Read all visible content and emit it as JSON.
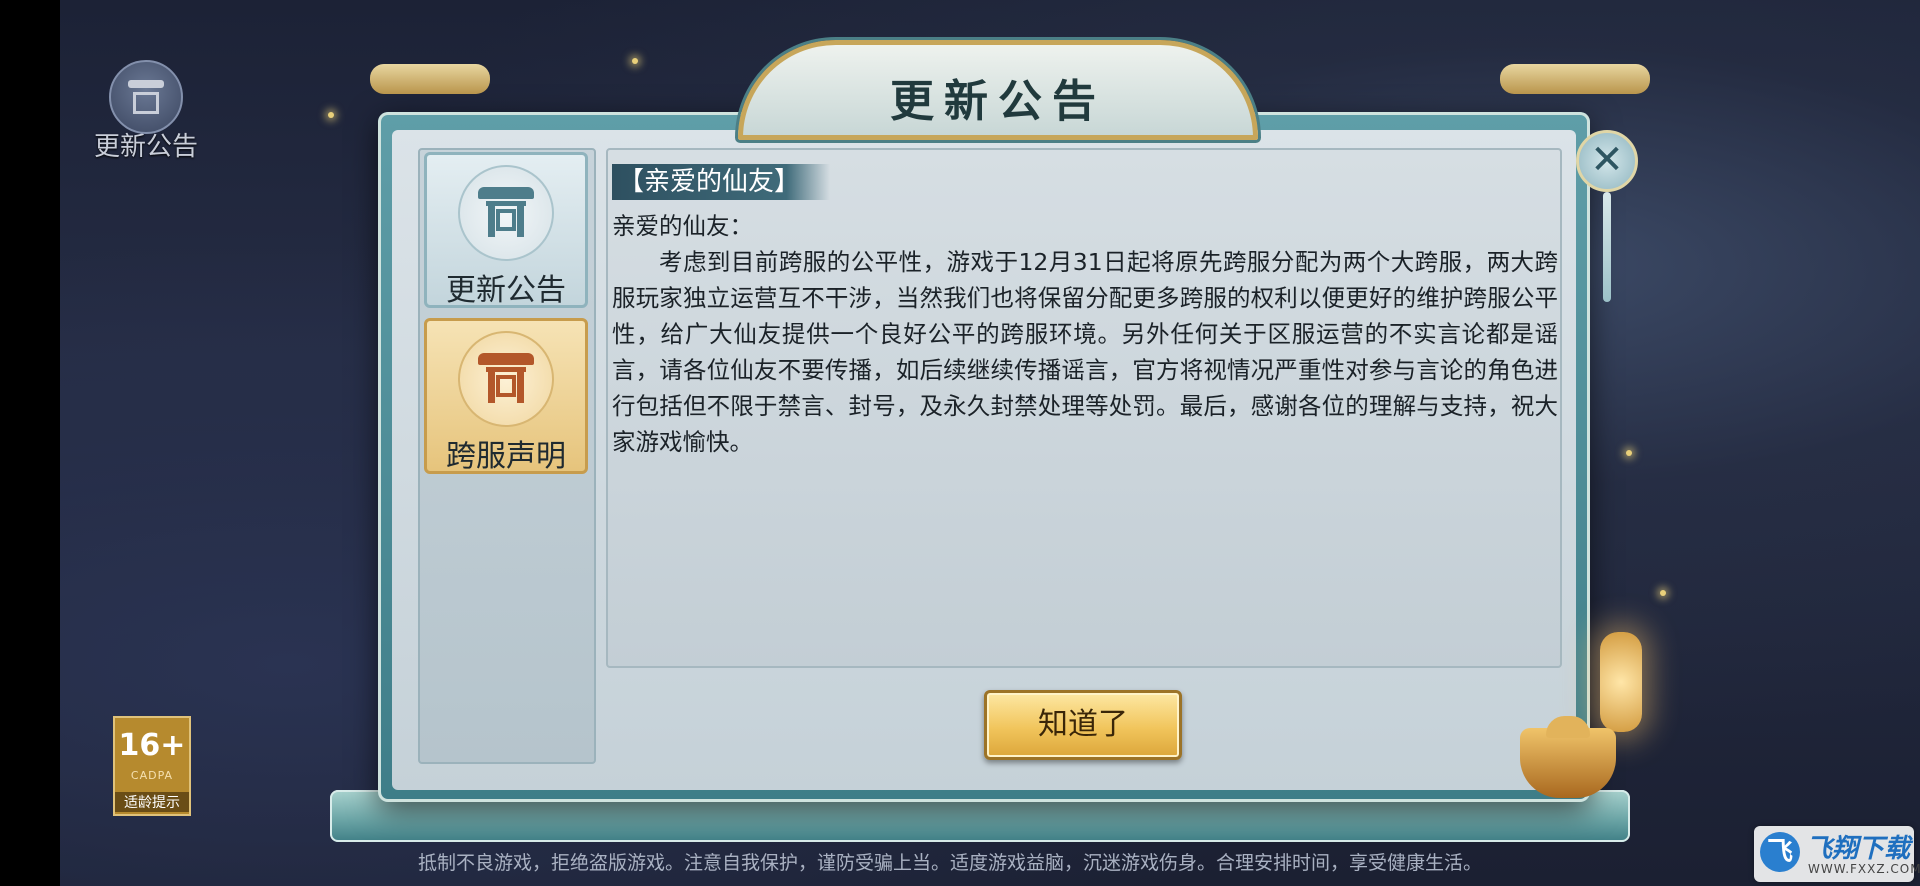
{
  "top_left_button": {
    "label": "更新公告",
    "icon": "notice-pavilion-icon"
  },
  "age_rating": {
    "number": "16+",
    "org": "CADPA",
    "label": "适龄提示"
  },
  "dialog": {
    "title": "更新公告",
    "tabs": [
      {
        "label": "更新公告",
        "icon": "gate-icon",
        "active": true
      },
      {
        "label": "跨服声明",
        "icon": "gate-icon",
        "active": false
      }
    ],
    "header": "【亲爱的仙友】",
    "greeting": "亲爱的仙友：",
    "body": "考虑到目前跨服的公平性，游戏于12月31日起将原先跨服分配为两个大跨服，两大跨服玩家独立运营互不干涉，当然我们也将保留分配更多跨服的权利以便更好的维护跨服公平性，给广大仙友提供一个良好公平的跨服环境。另外任何关于区服运营的不实言论都是谣言，请各位仙友不要传播，如后续继续传播谣言，官方将视情况严重性对参与言论的角色进行包括但不限于禁言、封号，及永久封禁处理等处罚。最后，感谢各位的理解与支持，祝大家游戏愉快。",
    "confirm_label": "知道了",
    "close_icon": "close-icon",
    "close_glyph": "✕"
  },
  "health_notice": "抵制不良游戏，拒绝盗版游戏。注意自我保护，谨防受骗上当。适度游戏益脑，沉迷游戏伤身。合理安排时间，享受健康生活。",
  "watermark": {
    "logo": "飞",
    "name": "飞翔下载",
    "url": "WWW.FXXZ.COM"
  },
  "colors": {
    "frame": "#4f8f99",
    "button_gold": "#f1c55c",
    "header_bar": "#2e5060"
  }
}
